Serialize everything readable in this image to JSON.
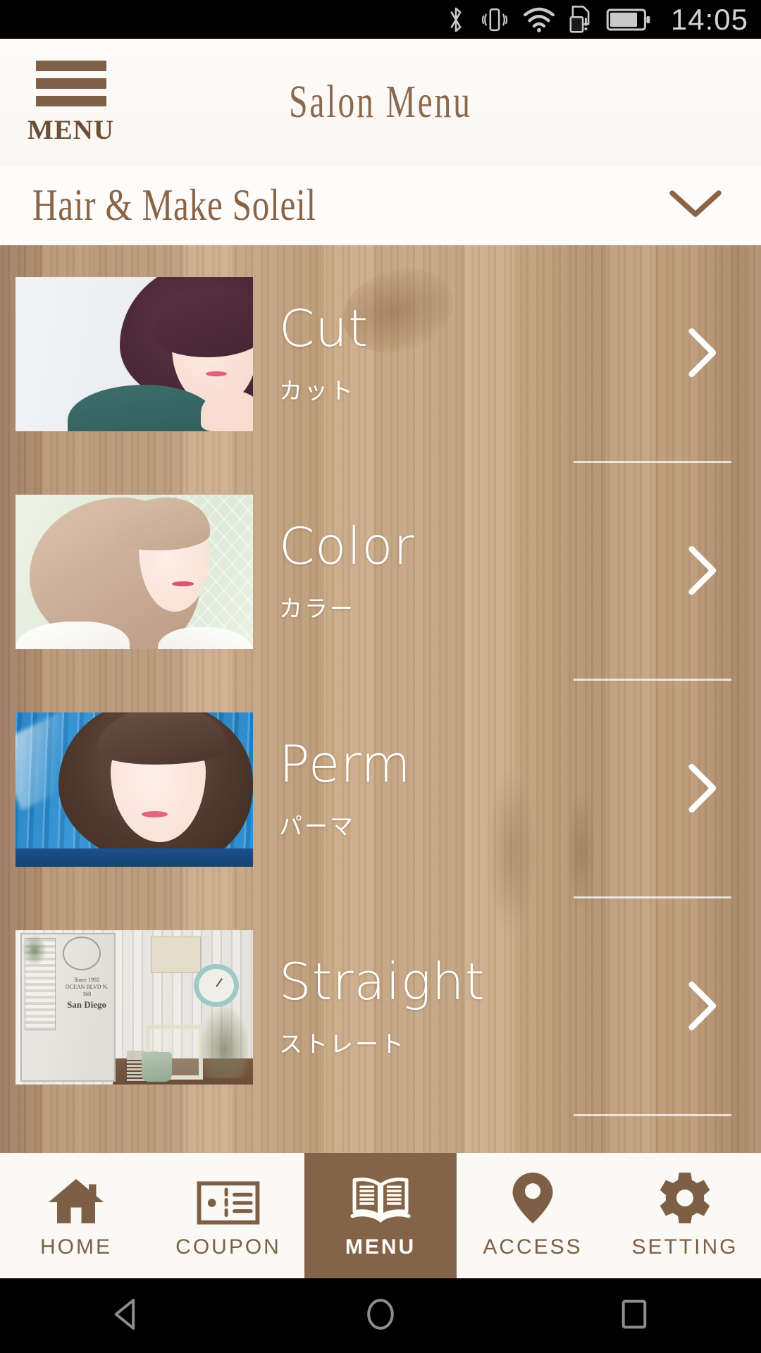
{
  "status_bar": {
    "time": "14:05",
    "icons": [
      "bluetooth-icon",
      "vibrate-icon",
      "wifi-icon",
      "sd-card-alert-icon",
      "battery-icon"
    ],
    "battery_level": 75
  },
  "header": {
    "menu_button_label": "MENU",
    "title": "Salon Menu",
    "hamburger_icon": "hamburger-icon"
  },
  "salon_bar": {
    "name": "Hair & Make Soleil",
    "expand_icon": "chevron-down-icon"
  },
  "menu_items": [
    {
      "en": "Cut",
      "ja": "カット",
      "thumbnail_alt": "Woman with dark short bob hairstyle in teal top",
      "arrow_icon": "chevron-right-icon"
    },
    {
      "en": "Color",
      "ja": "カラー",
      "thumbnail_alt": "Woman with ash beige bob hairstyle outdoors",
      "arrow_icon": "chevron-right-icon"
    },
    {
      "en": "Perm",
      "ja": "パーマ",
      "thumbnail_alt": "Woman with wavy brown hair against blue wall",
      "arrow_icon": "chevron-right-icon"
    },
    {
      "en": "Straight",
      "ja": "ストレート",
      "thumbnail_alt": "Salon interior with whitewashed wood, clock and frames",
      "arrow_icon": "chevron-right-icon"
    }
  ],
  "salon_photo_text": {
    "line1": "Since 1992",
    "line2": "OCEAN BLVD N. 168",
    "line3": "San Diego"
  },
  "tabs": [
    {
      "label": "HOME",
      "icon": "home-icon",
      "active": false
    },
    {
      "label": "COUPON",
      "icon": "ticket-icon",
      "active": false
    },
    {
      "label": "MENU",
      "icon": "book-icon",
      "active": true
    },
    {
      "label": "ACCESS",
      "icon": "map-pin-icon",
      "active": false
    },
    {
      "label": "SETTING",
      "icon": "gear-icon",
      "active": false
    }
  ],
  "android_nav": [
    {
      "name": "back-button",
      "icon": "triangle-left-icon"
    },
    {
      "name": "home-button",
      "icon": "circle-icon"
    },
    {
      "name": "recents-button",
      "icon": "square-icon"
    }
  ],
  "colors": {
    "brand_brown": "#836449",
    "text_brown": "#7d5f45",
    "title_brown": "#8a6a4f",
    "panel_bg": "#fbf9f6",
    "wood_mid": "#c6a47f"
  }
}
